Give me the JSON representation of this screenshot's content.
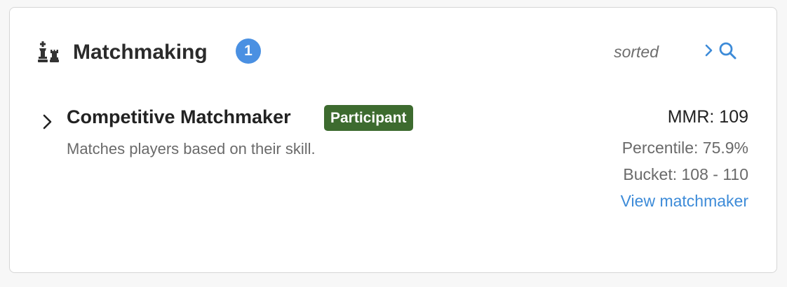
{
  "header": {
    "icon": "chess-pieces-icon",
    "title": "Matchmaking",
    "count": "1",
    "sort_label": "sorted",
    "actions_icons": [
      "chevron-right-icon",
      "search-icon"
    ]
  },
  "matchmakers": [
    {
      "expand_icon": "chevron-right-icon",
      "name": "Competitive Matchmaker",
      "role_badge": "Participant",
      "description": "Matches players based on their skill.",
      "mmr": "MMR: 109",
      "percentile": "Percentile: 75.9%",
      "bucket": "Bucket: 108 - 110",
      "link_label": "View matchmaker"
    }
  ],
  "colors": {
    "accent_blue": "#4a90e2",
    "link_blue": "#3d8bd8",
    "participant_green": "#3d6b2f"
  }
}
